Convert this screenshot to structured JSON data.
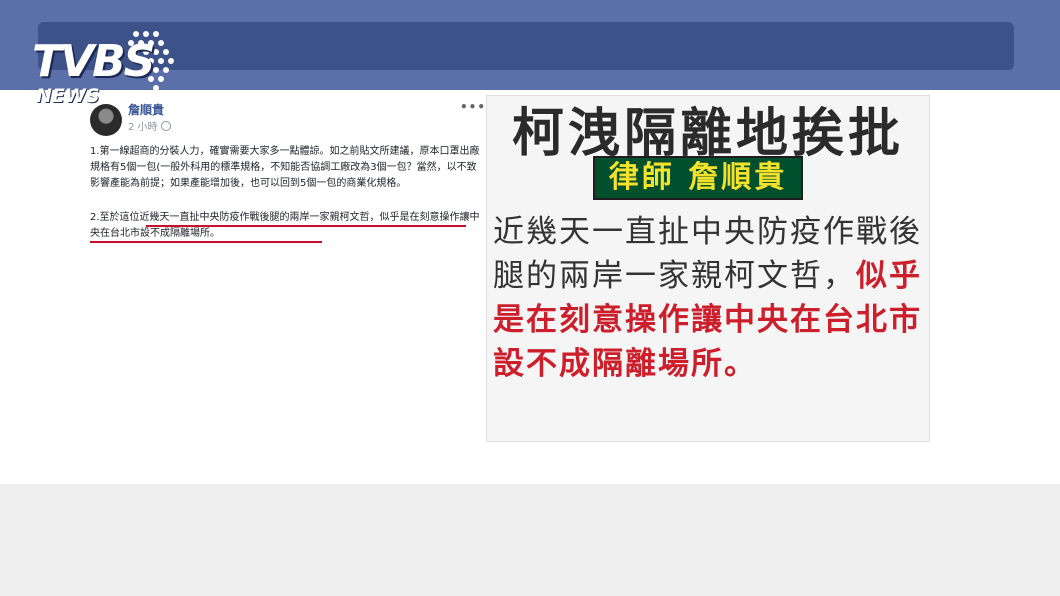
{
  "logo": {
    "main": "TVBS",
    "sub": "NEWS"
  },
  "post": {
    "author": "詹順貴",
    "time": "2 小時",
    "more": "•••",
    "paragraph1": "1.第一線超商的分裝人力，確實需要大家多一點體諒。如之前貼文所建議，原本口罩出廠規格有5個一包(一般外科用的標準規格，不知能否協調工廠改為3個一包？當然，以不致影響產能為前提；如果產能增加後，也可以回到5個一包的商業化規格。",
    "paragraph2": "2.至於這位近幾天一直扯中央防疫作戰後腿的兩岸一家親柯文哲，似乎是在刻意操作讓中央在台北市設不成隔離場所。"
  },
  "panel": {
    "headline": "柯洩隔離地挨批",
    "tag": "律師 詹順貴",
    "quote_normal": "近幾天一直扯中央防疫作戰後腿的兩岸一家親柯文哲，",
    "quote_highlight": "似乎是在刻意操作讓中央在台北市設不成隔離場所。"
  },
  "colors": {
    "topbar": "#5b6fa8",
    "searchbar": "#3d5289",
    "highlight_red": "#cc1f2b",
    "tag_bg": "#004f2d",
    "tag_text": "#f7e22b"
  }
}
